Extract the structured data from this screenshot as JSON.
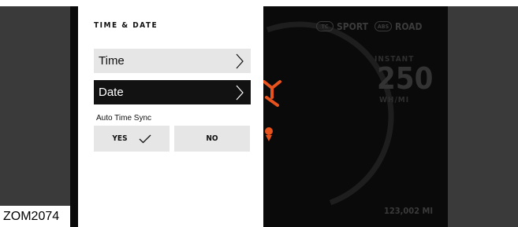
{
  "panel": {
    "title": "TIME & DATE",
    "rows": [
      {
        "label": "Time",
        "selected": false
      },
      {
        "label": "Date",
        "selected": true
      }
    ],
    "auto_sync_label": "Auto Time Sync",
    "yes_label": "YES",
    "no_label": "NO",
    "selected_option": "YES"
  },
  "cluster": {
    "tc_badge": "TC",
    "mode_label": "SPORT",
    "abs_badge": "ABS",
    "road_label": "ROAD",
    "instant_label": "INSTANT",
    "instant_value": "250",
    "instant_unit": "WH/MI",
    "odometer": "123,002 MI"
  },
  "caption": "ZOM2074",
  "colors": {
    "accent_orange": "#e8521c",
    "panel_bg": "#ffffff",
    "row_bg": "#e6e6e6",
    "selected_bg": "#121212"
  },
  "icons": [
    "chevron-right-icon",
    "checkmark-icon",
    "traction-control-icon",
    "abs-icon"
  ]
}
